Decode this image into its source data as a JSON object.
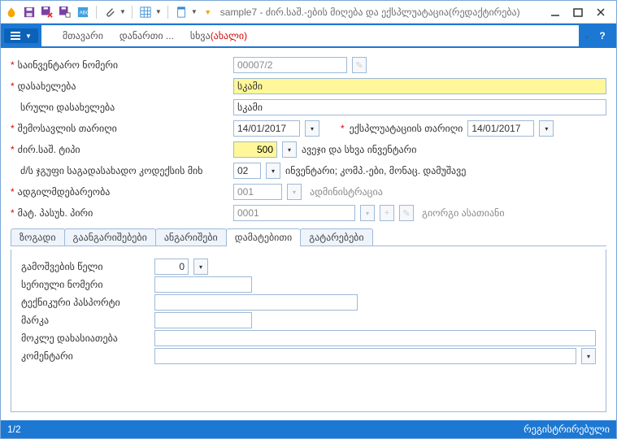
{
  "title": "sample7 - ძირ.საშ.-ების მიღება და ექსპლუატაცია(რედაქტირება)",
  "menus": {
    "main": "მთავარი",
    "attach": "დანართი ...",
    "other": "სხვა",
    "other_suffix": "(ახალი)"
  },
  "form": {
    "inv_no": {
      "label": "საინვენტარო ნომერი",
      "value": "00007/2"
    },
    "name": {
      "label": "დასახელება",
      "value": "სკამი"
    },
    "full_name": {
      "label": "სრული დასახელება",
      "value": "სკამი"
    },
    "income_date": {
      "label": "შემოსავლის თარიღი",
      "value": "14/01/2017"
    },
    "exploit_date": {
      "label": "ექსპლუატაციის თარიღი",
      "value": "14/01/2017"
    },
    "type": {
      "label": "ძირ.საშ. ტიპი",
      "code": "500",
      "desc": "ავეჯი და სხვა ინვენტარი"
    },
    "tax_group": {
      "label": "ძ/ს ჯგუფი საგადასახადო კოდექსის მიხ",
      "code": "02",
      "desc": "ინვენტარი; კომპ.-ები, მონაც. დამუშავე"
    },
    "location": {
      "label": "ადგილმდებარეობა",
      "code": "001",
      "desc": "ადმინისტრაცია"
    },
    "resp_person": {
      "label": "მატ. პასუხ. პირი",
      "code": "0001",
      "desc": "გიორგი ასათიანი"
    }
  },
  "tabs": {
    "general": "ზოგადი",
    "accoutings": "გაანგარიშებები",
    "accounts": "ანგარიშები",
    "additional": "დამატებითი",
    "moves": "გატარებები"
  },
  "additional": {
    "year": {
      "label": "გამოშვების წელი",
      "value": "0"
    },
    "serial": {
      "label": "სერიული ნომერი",
      "value": ""
    },
    "passport": {
      "label": "ტექნიკური პასპორტი",
      "value": ""
    },
    "brand": {
      "label": "მარკა",
      "value": ""
    },
    "short": {
      "label": "მოკლე დახასიათება",
      "value": ""
    },
    "comment": {
      "label": "კომენტარი",
      "value": ""
    }
  },
  "status": {
    "page": "1/2",
    "state": "რეგისტრირებული"
  }
}
